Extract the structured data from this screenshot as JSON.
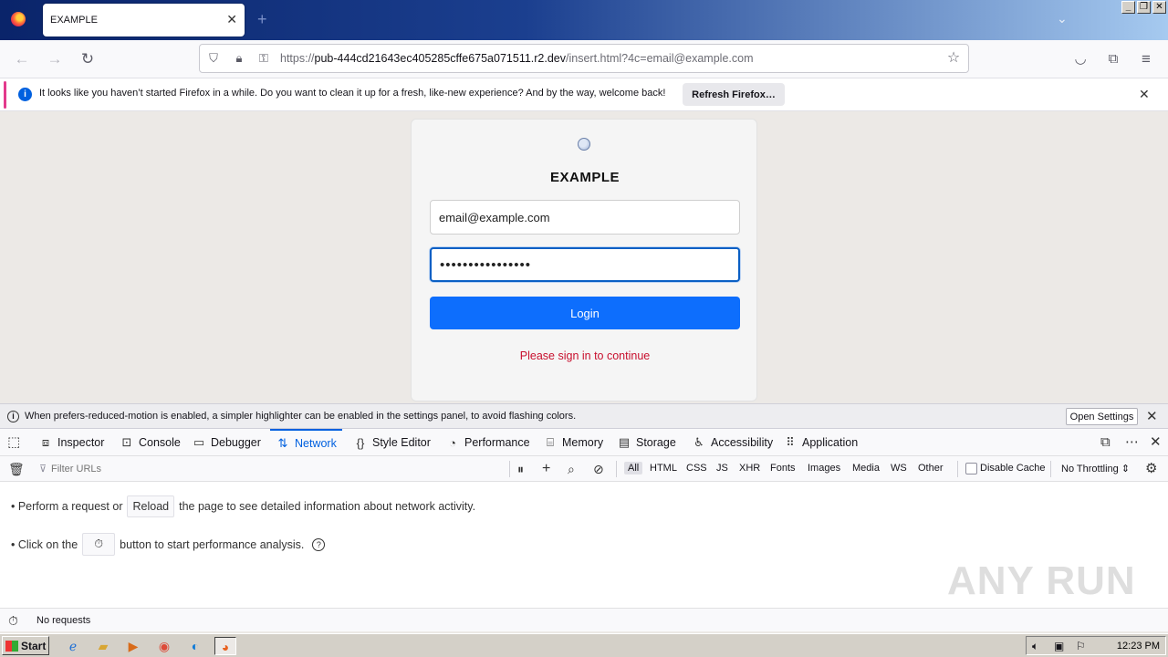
{
  "browser": {
    "tab_title": "EXAMPLE",
    "url_prefix": "https://",
    "url_host": "pub-444cd21643ec405285cffe675a071511.r2.dev",
    "url_path": "/insert.html?4c=email@example.com"
  },
  "notification": {
    "text": "It looks like you haven’t started Firefox in a while. Do you want to clean it up for a fresh, like-new experience? And by the way, welcome back!",
    "button": "Refresh Firefox…"
  },
  "login": {
    "title": "EXAMPLE",
    "email_value": "email@example.com",
    "password_value": "••••••••••••••••",
    "button": "Login",
    "message": "Please sign in to continue"
  },
  "devtools": {
    "notice_text": "When prefers-reduced-motion is enabled, a simpler highlighter can be enabled in the settings panel, to avoid flashing colors.",
    "open_settings": "Open Settings",
    "tabs": [
      "Inspector",
      "Console",
      "Debugger",
      "Network",
      "Style Editor",
      "Performance",
      "Memory",
      "Storage",
      "Accessibility",
      "Application"
    ],
    "active_tab": "Network",
    "filter_placeholder": "Filter URLs",
    "type_filters": [
      "All",
      "HTML",
      "CSS",
      "JS",
      "XHR",
      "Fonts",
      "Images",
      "Media",
      "WS",
      "Other"
    ],
    "disable_cache": "Disable Cache",
    "throttling": "No Throttling ⇕",
    "line1_a": "• Perform a request or",
    "reload": "Reload",
    "line1_b": "the page to see detailed information about network activity.",
    "line2_a": "• Click on the",
    "line2_b": "button to start performance analysis.",
    "status": "No requests"
  },
  "watermark": "ANY RUN",
  "taskbar": {
    "start": "Start",
    "clock": "12:23 PM"
  },
  "colors": {
    "accent": "#0060df",
    "login_button": "#0d6efd",
    "error": "#c8102e"
  }
}
